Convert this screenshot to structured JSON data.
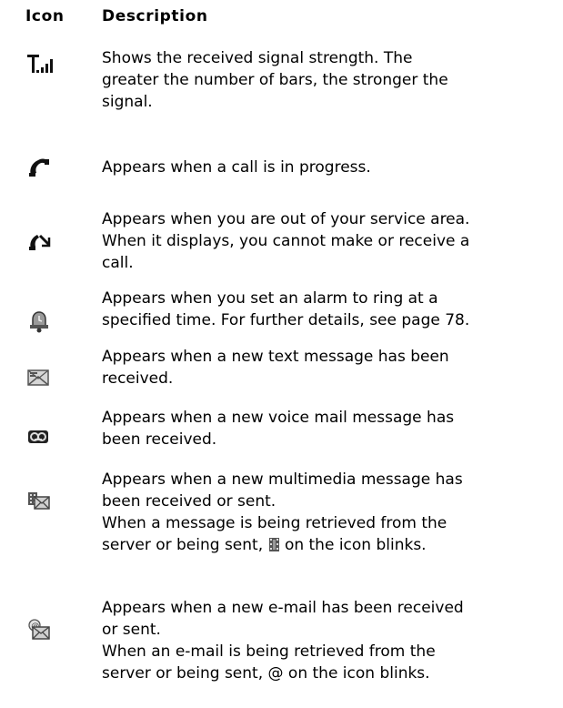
{
  "headers": {
    "icon": "Icon",
    "description": "Description"
  },
  "rows": [
    {
      "icon": "signal-strength-icon",
      "lines": [
        "Shows the received signal strength. The",
        "greater the number of bars, the stronger the",
        "signal."
      ]
    },
    {
      "icon": "call-in-progress-icon",
      "lines": [
        "Appears when a call is in progress."
      ]
    },
    {
      "icon": "no-service-icon",
      "lines": [
        "Appears when you are out of your service area.",
        "When it displays, you cannot make or receive a",
        "call."
      ]
    },
    {
      "icon": "alarm-icon",
      "lines": [
        "Appears when you set an alarm to ring at a",
        "specified time. For further details, see page 78."
      ]
    },
    {
      "icon": "text-message-icon",
      "lines": [
        "Appears when a new text message has been",
        "received."
      ]
    },
    {
      "icon": "voice-mail-icon",
      "lines": [
        "Appears when a new voice mail message has",
        "been received."
      ]
    },
    {
      "icon": "multimedia-message-icon",
      "lines": [
        "Appears when a new multimedia message has",
        "been received or sent.",
        "When a message is being retrieved from the"
      ],
      "line4_before": "server or being sent,",
      "line4_after": "on the icon blinks."
    },
    {
      "icon": "email-icon",
      "lines": [
        "Appears when a new e-mail has been received",
        "or sent.",
        "When an e-mail is being retrieved from the",
        "server or being sent, @ on the icon blinks."
      ]
    }
  ]
}
